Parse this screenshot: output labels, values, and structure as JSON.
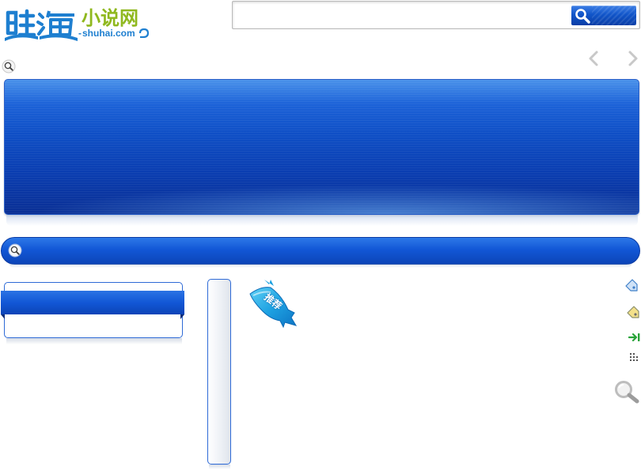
{
  "logo": {
    "cn_text": "小说网",
    "en_text": "shuhai.com"
  },
  "search": {
    "placeholder": "",
    "button_icon": "search-icon"
  },
  "navigation": {
    "prev_icon": "chevron-left-icon",
    "next_icon": "chevron-right-icon"
  },
  "recommend": {
    "label": "推荐"
  },
  "icons": {
    "tag_blue": "tag-icon",
    "tag_yellow": "tag-icon",
    "login_arrow": "arrow-right-icon",
    "grid_dots": "grid-icon",
    "magnifier_large": "search-icon"
  },
  "colors": {
    "primary_blue": "#1257d6",
    "dark_blue": "#0a3aa3",
    "logo_green": "#8fb81e",
    "logo_blue": "#1e7fd0"
  }
}
